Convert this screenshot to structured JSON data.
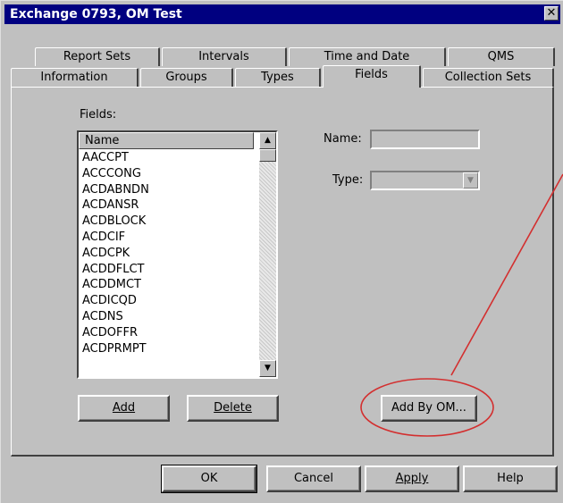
{
  "window": {
    "title": "Exchange 0793, OM Test",
    "close_glyph": "✕"
  },
  "tabs": {
    "row1": [
      "Report Sets",
      "Intervals",
      "Time and Date",
      "QMS"
    ],
    "row2": [
      "Information",
      "Groups",
      "Types",
      "Fields",
      "Collection Sets"
    ],
    "active": "Fields"
  },
  "fields_panel": {
    "list_label": "Fields:",
    "column_header": "Name",
    "items": [
      "AACCPT",
      "ACCCONG",
      "ACDABNDN",
      "ACDANSR",
      "ACDBLOCK",
      "ACDCIF",
      "ACDCPK",
      "ACDDFLCT",
      "ACDDMCT",
      "ACDICQD",
      "ACDNS",
      "ACDOFFR",
      "ACDPRMPT"
    ],
    "name_label": "Name:",
    "name_value": "",
    "type_label": "Type:",
    "type_value": "",
    "add_label": "Add",
    "delete_label": "Delete",
    "add_by_om_label": "Add By OM..."
  },
  "footer": {
    "ok": "OK",
    "cancel": "Cancel",
    "apply": "Apply",
    "help": "Help"
  },
  "icons": [
    "close-icon",
    "scroll-up-icon",
    "scroll-down-icon",
    "dropdown-arrow-icon"
  ],
  "annotation_color": "#d32f2f"
}
